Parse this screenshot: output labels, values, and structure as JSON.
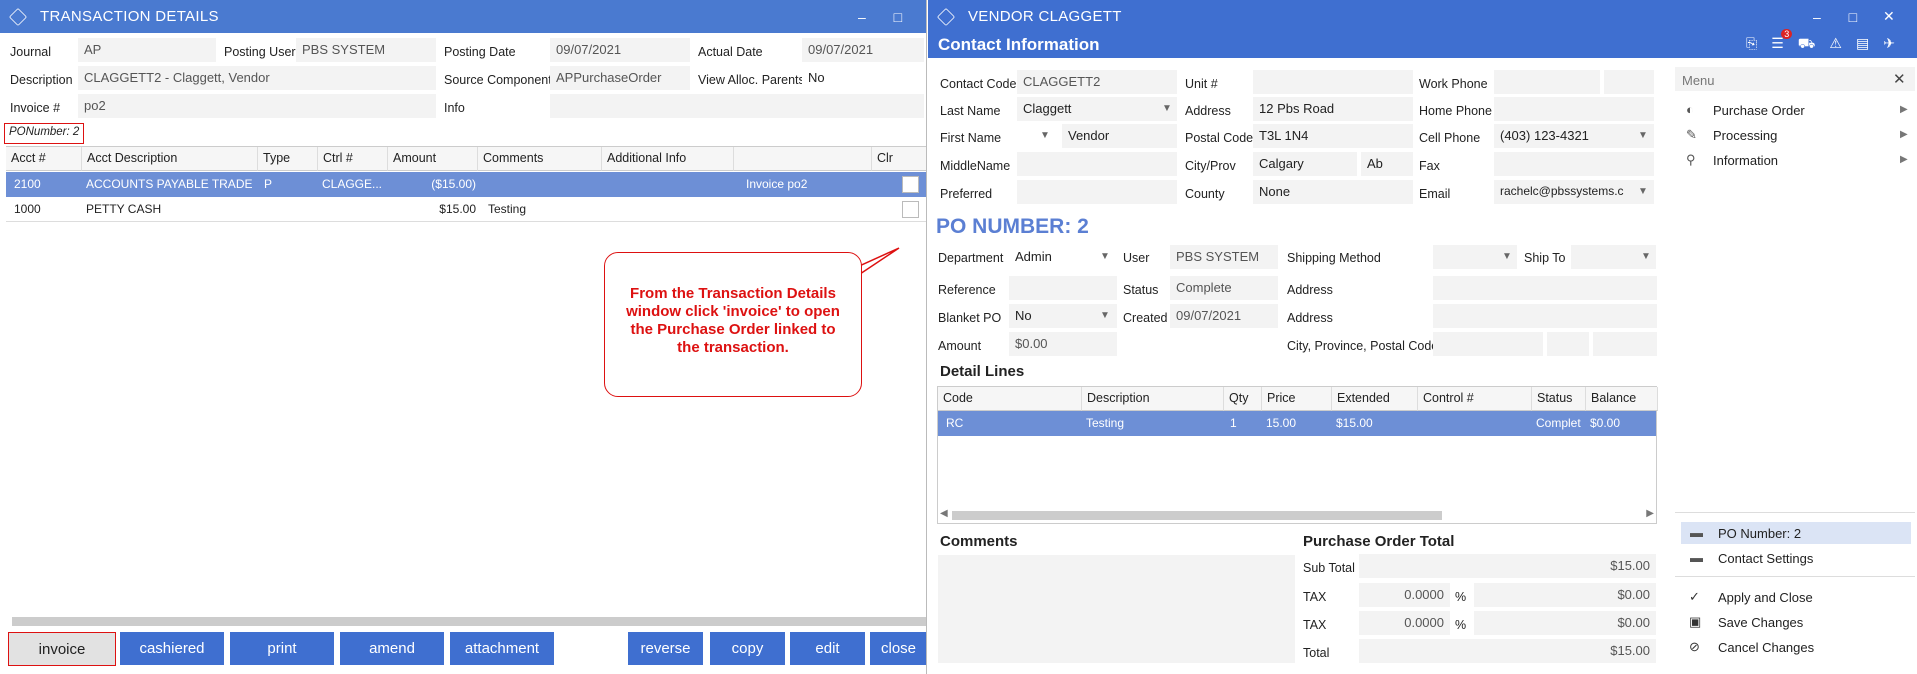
{
  "left": {
    "title": "TRANSACTION DETAILS",
    "fields": {
      "journal_label": "Journal",
      "journal": "AP",
      "posting_user_label": "Posting User",
      "posting_user": "PBS SYSTEM",
      "posting_date_label": "Posting Date",
      "posting_date": "09/07/2021",
      "actual_date_label": "Actual Date",
      "actual_date": "09/07/2021",
      "description_label": "Description",
      "description": "CLAGGETT2 - Claggett, Vendor",
      "source_label": "Source Component",
      "source": "APPurchaseOrder",
      "view_alloc_label": "View Alloc. Parents",
      "view_alloc": "No",
      "invoice_label": "Invoice #",
      "invoice": "po2",
      "info_label": "Info",
      "info": ""
    },
    "po_tag": "PONumber: 2",
    "grid": {
      "headers": [
        "Acct #",
        "Acct Description",
        "Type",
        "Ctrl #",
        "Amount",
        "Comments",
        "Additional Info",
        "",
        "Clr"
      ],
      "rows": [
        {
          "acct": "2100",
          "desc": "ACCOUNTS PAYABLE TRADE",
          "type": "P",
          "ctrl": "CLAGGE...",
          "amount": "($15.00)",
          "comments": "",
          "addl": "",
          "extra": "Invoice po2"
        },
        {
          "acct": "1000",
          "desc": "PETTY CASH",
          "type": "",
          "ctrl": "",
          "amount": "$15.00",
          "comments": "Testing",
          "addl": "",
          "extra": ""
        }
      ]
    },
    "callout": "From the Transaction Details window click 'invoice' to open the Purchase Order linked to the transaction.",
    "buttons": {
      "invoice": "invoice",
      "cashiered": "cashiered",
      "print": "print",
      "amend": "amend",
      "attachment": "attachment",
      "reverse": "reverse",
      "copy": "copy",
      "edit": "edit",
      "close": "close"
    }
  },
  "right": {
    "title": "VENDOR CLAGGETT",
    "subtitle": "Contact Information",
    "notif_count": "3",
    "contact": {
      "contact_code_label": "Contact Code",
      "contact_code": "CLAGGETT2",
      "unit_label": "Unit #",
      "unit": "",
      "work_phone_label": "Work Phone",
      "work_phone": "",
      "last_name_label": "Last Name",
      "last_name": "Claggett",
      "address_label": "Address",
      "address": "12 Pbs Road",
      "home_phone_label": "Home Phone",
      "home_phone": "",
      "first_name_label": "First Name",
      "first_name": "Vendor",
      "postal_label": "Postal Code",
      "postal": "T3L 1N4",
      "cell_label": "Cell Phone",
      "cell": "(403) 123-4321",
      "middle_label": "MiddleName",
      "middle": "",
      "city_label": "City/Prov",
      "city": "Calgary",
      "prov": "Ab",
      "fax_label": "Fax",
      "fax": "",
      "preferred_label": "Preferred",
      "preferred": "",
      "county_label": "County",
      "county": "None",
      "email_label": "Email",
      "email": "rachelc@pbssystems.c"
    },
    "po_title": "PO NUMBER: 2",
    "po": {
      "dept_label": "Department",
      "dept": "Admin",
      "user_label": "User",
      "user": "PBS SYSTEM",
      "ship_method_label": "Shipping Method",
      "ship_method": "",
      "ship_to_label": "Ship To",
      "ship_to": "",
      "ref_label": "Reference",
      "ref": "",
      "status_label": "Status",
      "status": "Complete",
      "address1_label": "Address",
      "address1": "",
      "blanket_label": "Blanket PO",
      "blanket": "No",
      "created_label": "Created",
      "created": "09/07/2021",
      "address2_label": "Address",
      "address2": "",
      "amount_label": "Amount",
      "amount": "$0.00",
      "cpp_label": "City, Province, Postal Code"
    },
    "detail_title": "Detail Lines",
    "detail": {
      "headers": [
        "Code",
        "Description",
        "Qty",
        "Price",
        "Extended",
        "Control #",
        "Status",
        "Balance"
      ],
      "rows": [
        {
          "code": "RC",
          "desc": "Testing",
          "qty": "1",
          "price": "15.00",
          "extended": "$15.00",
          "control": "",
          "status": "Complet",
          "balance": "$0.00"
        }
      ]
    },
    "comments_title": "Comments",
    "total_title": "Purchase Order Total",
    "totals": {
      "sub_label": "Sub Total",
      "sub": "$15.00",
      "tax1_label": "TAX",
      "tax1_rate": "0.0000",
      "tax1_pct": "%",
      "tax1": "$0.00",
      "tax2_label": "TAX",
      "tax2_rate": "0.0000",
      "tax2_pct": "%",
      "tax2": "$0.00",
      "total_label": "Total",
      "total": "$15.00"
    },
    "menu": {
      "title": "Menu",
      "items": [
        "Purchase Order",
        "Processing",
        "Information"
      ],
      "lower": [
        "PO Number: 2",
        "Contact Settings"
      ],
      "actions": [
        "Apply and Close",
        "Save Changes",
        "Cancel Changes"
      ]
    }
  },
  "colors": {
    "titlebar": "#4a7ad0",
    "button": "#3f6fd0",
    "selected_row": "#6d8fd6",
    "callout": "#dd1111",
    "po_title": "#5b7fd3"
  }
}
